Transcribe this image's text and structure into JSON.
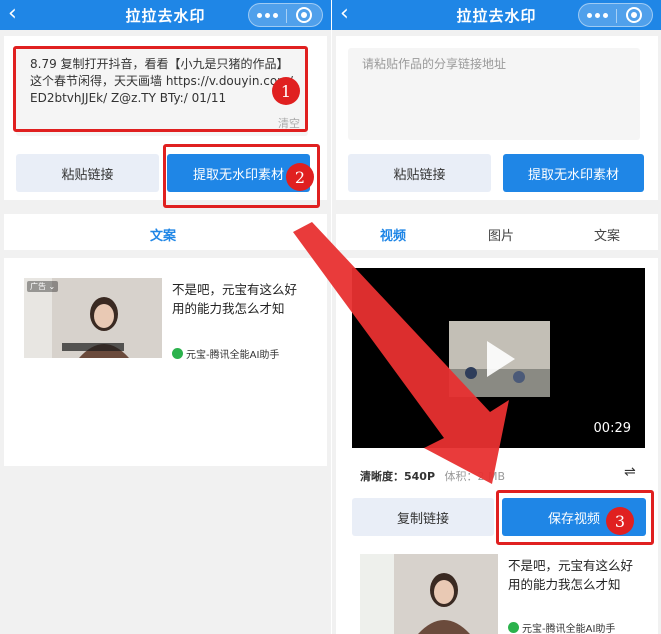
{
  "left": {
    "nav": {
      "back": "‹",
      "title": "拉拉去水印"
    },
    "input": {
      "value": "8.79 复制打开抖音，看看【小九是只猪的作品】这个春节闲得，天天画墙  https://v.douyin.com/ED2btvhJJEk/ Z@z.TY BTy:/ 01/11",
      "clear": "清空"
    },
    "buttons": {
      "paste": "粘贴链接",
      "extract": "提取无水印素材"
    },
    "tabs": [
      "文案"
    ],
    "ad": {
      "tag": "广告 ⌄",
      "text": "不是吧，元宝有这么好用的能力我怎么才知",
      "source": "元宝-腾讯全能AI助手"
    }
  },
  "right": {
    "nav": {
      "back": "‹",
      "title": "拉拉去水印"
    },
    "input": {
      "placeholder": "请粘贴作品的分享链接地址"
    },
    "buttons": {
      "paste": "粘贴链接",
      "extract": "提取无水印素材"
    },
    "tabs": [
      "视频",
      "图片",
      "文案"
    ],
    "video": {
      "duration": "00:29"
    },
    "meta": {
      "resolution": "清晰度：540P",
      "size": "体积：2 MB",
      "swap": "⇌"
    },
    "actions": {
      "copy": "复制链接",
      "save": "保存视频"
    },
    "ad": {
      "text": "不是吧，元宝有这么好用的能力我怎么才知",
      "source": "元宝-腾讯全能AI助手"
    }
  },
  "annotations": {
    "step1": "1",
    "step2": "2",
    "step3": "3"
  },
  "colors": {
    "accent": "#1f86e6",
    "annotation": "#e02020"
  }
}
